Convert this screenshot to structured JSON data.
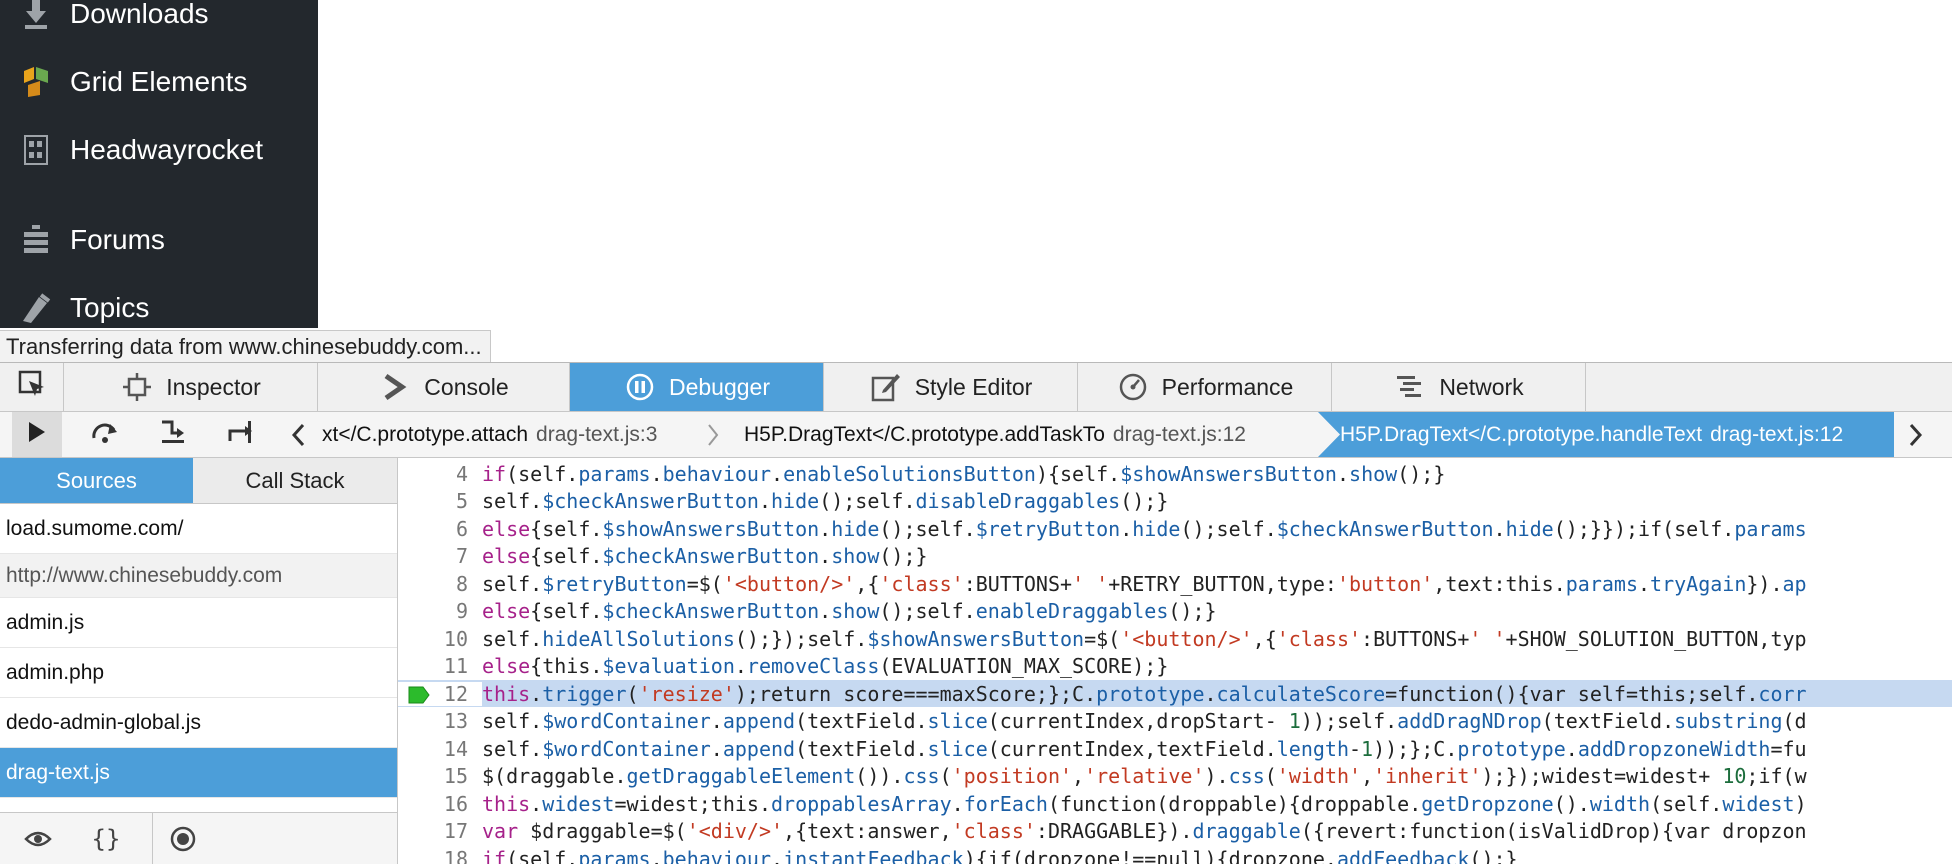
{
  "wp_sidebar": {
    "items": [
      {
        "label": "Downloads",
        "icon": "download-icon"
      },
      {
        "label": "Grid Elements",
        "icon": "grid-elements-icon"
      },
      {
        "label": "Headwayrocket",
        "icon": "headwayrocket-icon"
      },
      {
        "label": "Forums",
        "icon": "forums-icon"
      },
      {
        "label": "Topics",
        "icon": "topics-icon"
      }
    ]
  },
  "status": {
    "text": "Transferring data from www.chinesebuddy.com..."
  },
  "devtools": {
    "tabs": [
      {
        "label": "Inspector",
        "icon": "inspector-icon"
      },
      {
        "label": "Console",
        "icon": "console-icon"
      },
      {
        "label": "Debugger",
        "icon": "debugger-icon",
        "active": true
      },
      {
        "label": "Style Editor",
        "icon": "style-editor-icon"
      },
      {
        "label": "Performance",
        "icon": "performance-icon"
      },
      {
        "label": "Network",
        "icon": "network-icon"
      }
    ],
    "picker_icon": "element-picker-icon"
  },
  "toolbar": {
    "buttons": [
      "resume-icon",
      "step-over-icon",
      "step-in-icon",
      "step-out-icon"
    ],
    "breadcrumbs": [
      {
        "func": "xt</C.prototype.attach",
        "file": "drag-text.js:3"
      },
      {
        "func": "H5P.DragText</C.prototype.addTaskTo",
        "file": "drag-text.js:12"
      },
      {
        "func": "H5P.DragText</C.prototype.handleText",
        "file": "drag-text.js:12",
        "selected": true
      }
    ]
  },
  "sources": {
    "tabs": [
      "Sources",
      "Call Stack"
    ],
    "items": [
      {
        "label": "load.sumome.com/",
        "type": "item"
      },
      {
        "label": "http://www.chinesebuddy.com",
        "type": "group"
      },
      {
        "label": "admin.js",
        "type": "item"
      },
      {
        "label": "admin.php",
        "type": "item"
      },
      {
        "label": "dedo-admin-global.js",
        "type": "item"
      },
      {
        "label": "drag-text.js",
        "type": "item",
        "selected": true
      }
    ],
    "footer": [
      "eye-icon",
      "{}",
      "blackbox-icon"
    ]
  },
  "editor": {
    "current_line": 12,
    "lines": [
      {
        "n": "4",
        "text": "if(self.params.behaviour.enableSolutionsButton){self.$showAnswersButton.show();}"
      },
      {
        "n": "5",
        "text": "self.$checkAnswerButton.hide();self.disableDraggables();}"
      },
      {
        "n": "6",
        "text": "else{self.$showAnswersButton.hide();self.$retryButton.hide();self.$checkAnswerButton.hide();}});if(self.params"
      },
      {
        "n": "7",
        "text": "else{self.$checkAnswerButton.show();}"
      },
      {
        "n": "8",
        "text": "self.$retryButton=$('<button/>',{'class':BUTTONS+' '+RETRY_BUTTON,type:'button',text:this.params.tryAgain}).ap"
      },
      {
        "n": "9",
        "text": "else{self.$checkAnswerButton.show();self.enableDraggables();}"
      },
      {
        "n": "10",
        "text": "self.hideAllSolutions();});self.$showAnswersButton=$('<button/>',{'class':BUTTONS+' '+SHOW_SOLUTION_BUTTON,typ"
      },
      {
        "n": "11",
        "text": "else{this.$evaluation.removeClass(EVALUATION_MAX_SCORE);}"
      },
      {
        "n": "12",
        "text": "this.trigger('resize');return score===maxScore;};C.prototype.calculateScore=function(){var self=this;self.corr"
      },
      {
        "n": "13",
        "text": "self.$wordContainer.append(textField.slice(currentIndex,dropStart- 1));self.addDragNDrop(textField.substring(d"
      },
      {
        "n": "14",
        "text": "self.$wordContainer.append(textField.slice(currentIndex,textField.length-1));};C.prototype.addDropzoneWidth=fu"
      },
      {
        "n": "15",
        "text": "$(draggable.getDraggableElement()).css('position','relative').css('width','inherit');});widest=widest+ 10;if(w"
      },
      {
        "n": "16",
        "text": "this.widest=widest;this.droppablesArray.forEach(function(droppable){droppable.getDropzone().width(self.widest)"
      },
      {
        "n": "17",
        "text": "var $draggable=$('<div/>',{text:answer,'class':DRAGGABLE}).draggable({revert:function(isValidDrop){var dropzon"
      },
      {
        "n": "18",
        "text": "if(self.params.behaviour.instantFeedback){if(dropzone!==null){dropzone.addFeedback();}"
      }
    ]
  }
}
